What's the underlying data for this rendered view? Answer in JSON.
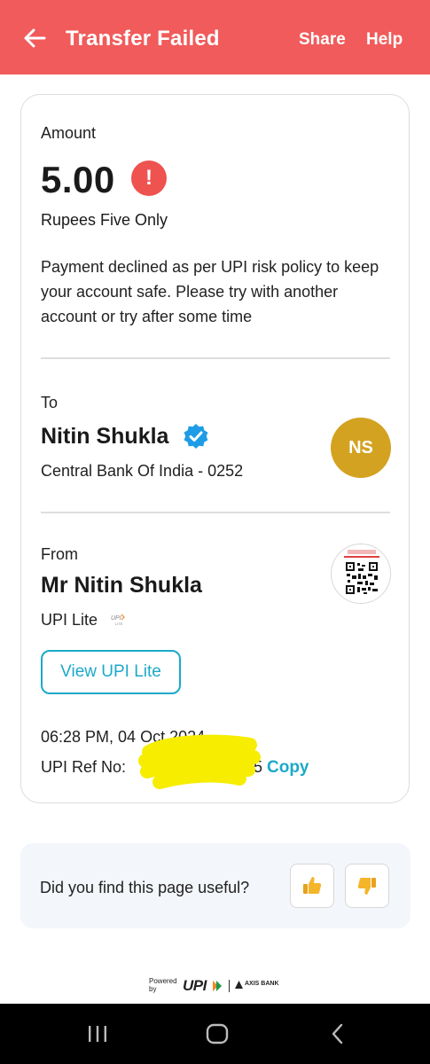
{
  "header": {
    "title": "Transfer Failed",
    "share_label": "Share",
    "help_label": "Help"
  },
  "amount": {
    "label": "Amount",
    "value": "5.00",
    "status_icon": "exclamation-icon",
    "in_words": "Rupees Five Only",
    "message": "Payment declined as per UPI risk policy to keep your account safe. Please try with another account or try after some time"
  },
  "to": {
    "label": "To",
    "name": "Nitin Shukla",
    "bank": "Central Bank Of India - 0252",
    "avatar_initials": "NS",
    "verified_icon": "verified-badge-icon"
  },
  "from": {
    "label": "From",
    "name": "Mr Nitin Shukla",
    "account": "UPI Lite",
    "view_button": "View UPI Lite"
  },
  "transaction": {
    "timestamp": "06:28 PM, 04 Oct 2024",
    "ref_label": "UPI Ref No:",
    "ref_tail": "5",
    "copy_label": "Copy"
  },
  "feedback": {
    "question": "Did you find this page useful?",
    "thumbs_up_icon": "thumbs-up-icon",
    "thumbs_down_icon": "thumbs-down-icon"
  },
  "footer": {
    "powered_by": "Powered by",
    "upi_text": "UPI",
    "bank_text": "AXIS BANK"
  },
  "colors": {
    "header_bg": "#f15b5b",
    "accent": "#1ca9c9",
    "error": "#ee5350",
    "avatar": "#d4a221"
  }
}
